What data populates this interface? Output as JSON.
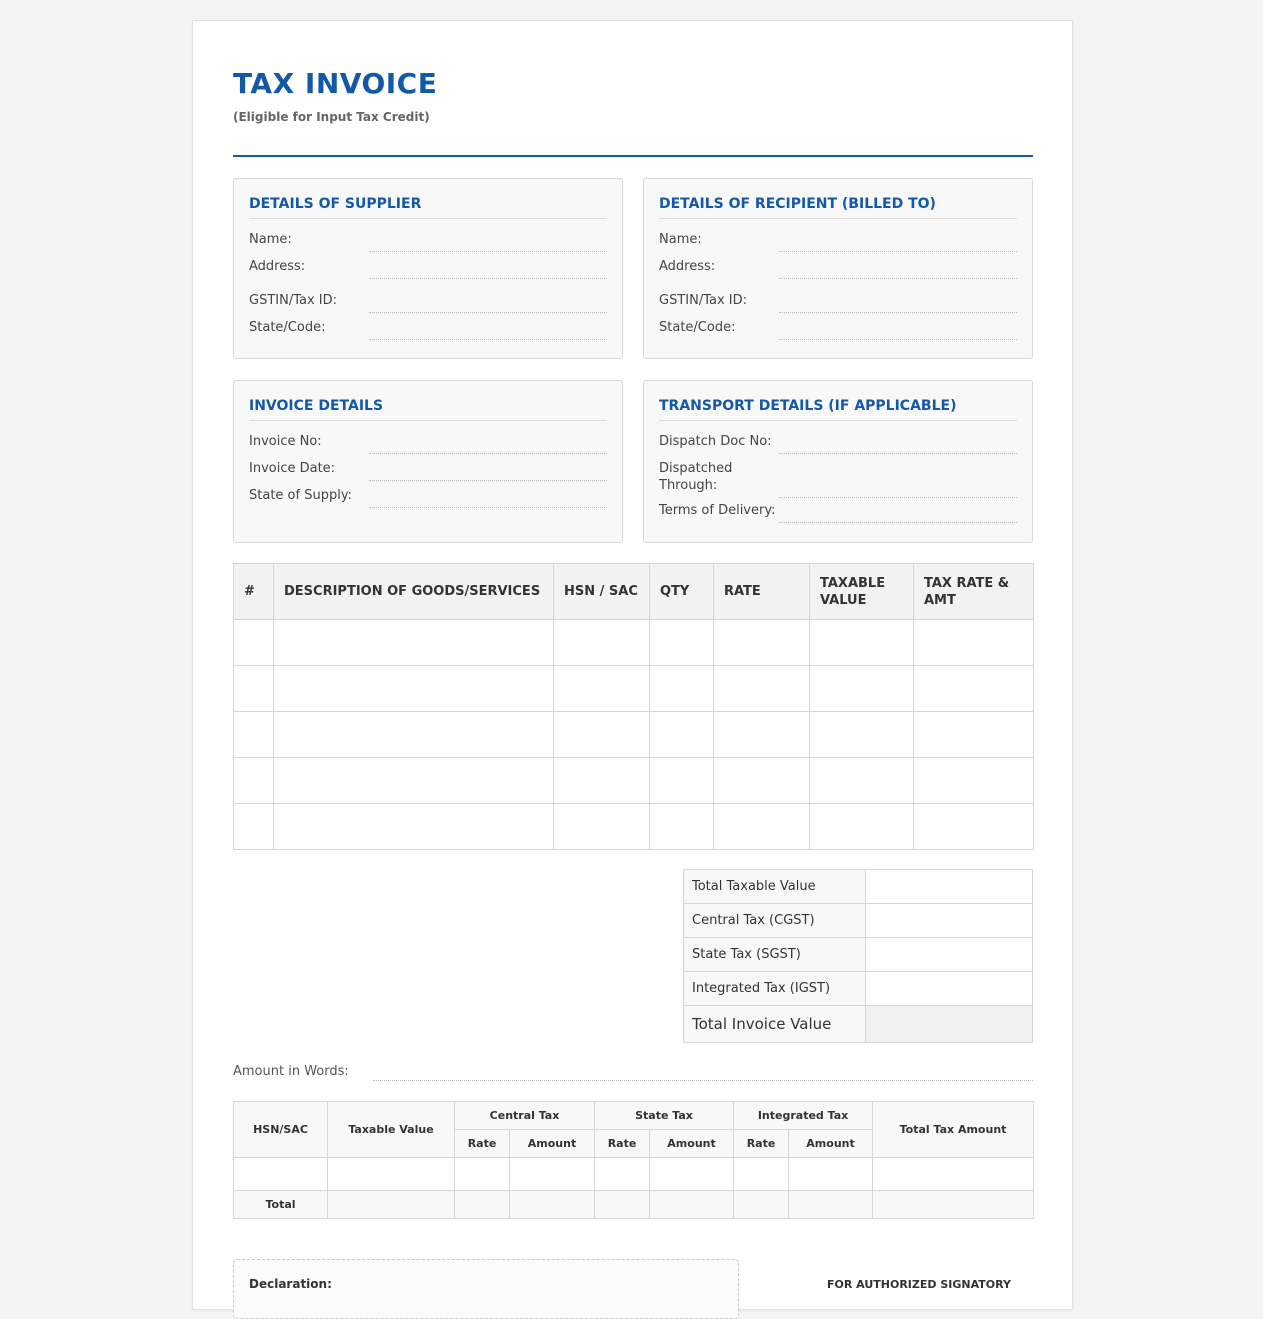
{
  "header": {
    "title": "TAX INVOICE",
    "subtitle": "(Eligible for Input Tax Credit)"
  },
  "supplier": {
    "title": "DETAILS OF SUPPLIER",
    "fields": [
      "Name:",
      "Address:",
      "GSTIN/Tax ID:",
      "State/Code:"
    ]
  },
  "recipient": {
    "title": "DETAILS OF RECIPIENT (BILLED TO)",
    "fields": [
      "Name:",
      "Address:",
      "GSTIN/Tax ID:",
      "State/Code:"
    ]
  },
  "invoice": {
    "title": "INVOICE DETAILS",
    "fields": [
      "Invoice No:",
      "Invoice Date:",
      "State of Supply:"
    ]
  },
  "transport": {
    "title": "TRANSPORT DETAILS (IF APPLICABLE)",
    "fields": [
      "Dispatch Doc No:",
      "Dispatched Through:",
      "Terms of Delivery:"
    ]
  },
  "items_table": {
    "headers": [
      "#",
      "DESCRIPTION OF GOODS/SERVICES",
      "HSN / SAC",
      "QTY",
      "RATE",
      "TAXABLE VALUE",
      "TAX RATE & AMT"
    ],
    "rows": [
      [
        "",
        "",
        "",
        "",
        "",
        "",
        ""
      ],
      [
        "",
        "",
        "",
        "",
        "",
        "",
        ""
      ],
      [
        "",
        "",
        "",
        "",
        "",
        "",
        ""
      ],
      [
        "",
        "",
        "",
        "",
        "",
        "",
        ""
      ],
      [
        "",
        "",
        "",
        "",
        "",
        "",
        ""
      ]
    ]
  },
  "totals": {
    "rows": [
      {
        "label": "Total Taxable Value",
        "value": ""
      },
      {
        "label": "Central Tax (CGST)",
        "value": ""
      },
      {
        "label": "State Tax (SGST)",
        "value": ""
      },
      {
        "label": "Integrated Tax (IGST)",
        "value": ""
      }
    ],
    "grand_label": "Total Invoice Value",
    "grand_value": ""
  },
  "amount_in_words": {
    "label": "Amount in Words:"
  },
  "hsn_table": {
    "hsn_header": "HSN/SAC",
    "taxable_header": "Taxable Value",
    "central_header": "Central Tax",
    "state_header": "State Tax",
    "integrated_header": "Integrated Tax",
    "total_tax_header": "Total Tax Amount",
    "rate_label": "Rate",
    "amount_label": "Amount",
    "total_label": "Total"
  },
  "footer": {
    "declaration_label": "Declaration:",
    "signatory_label": "FOR AUTHORIZED SIGNATORY"
  }
}
